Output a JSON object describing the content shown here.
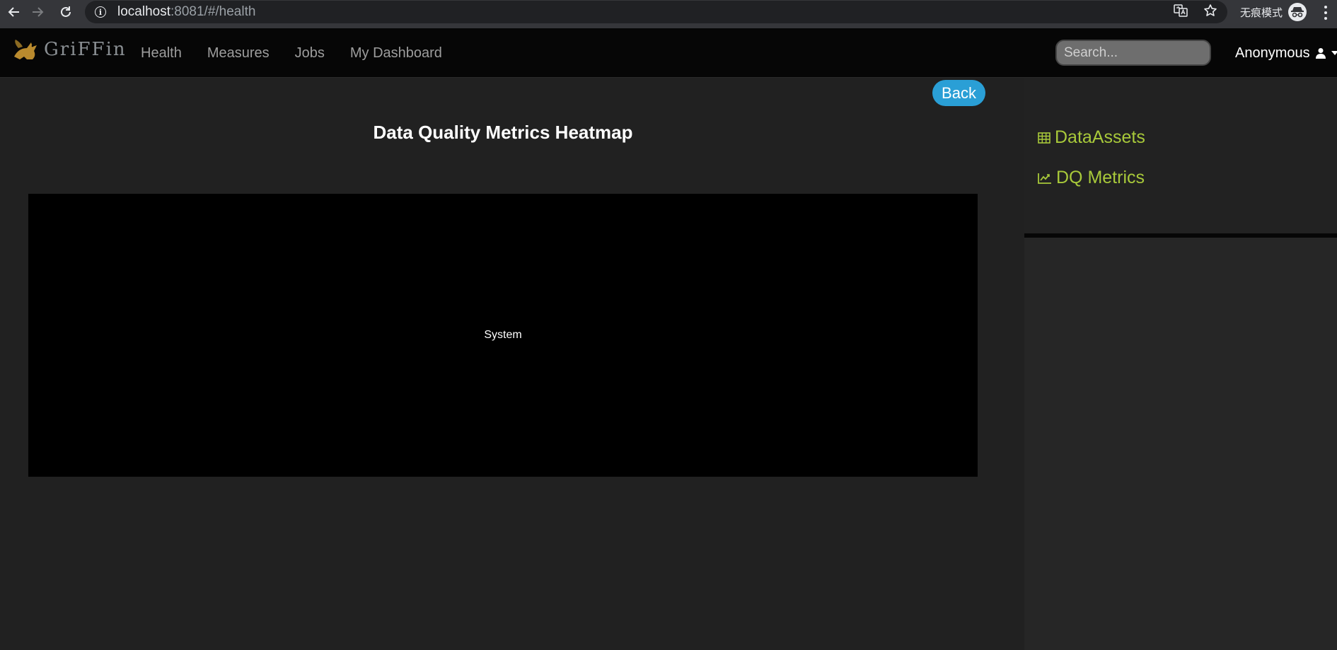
{
  "browser": {
    "url_host": "localhost",
    "url_path": ":8081/#/health",
    "incognito_label": "无痕模式",
    "icons": [
      "back-arrow-icon",
      "forward-arrow-icon",
      "reload-icon",
      "info-icon",
      "translate-icon",
      "bookmark-star-icon",
      "incognito-icon",
      "kebab-menu-icon"
    ]
  },
  "navbar": {
    "brand": "GriFFin",
    "links": [
      "Health",
      "Measures",
      "Jobs",
      "My Dashboard"
    ],
    "search_placeholder": "Search...",
    "user": "Anonymous",
    "icons": [
      "user-icon",
      "caret-down-icon"
    ]
  },
  "main": {
    "back_label": "Back",
    "title": "Data Quality Metrics Heatmap",
    "heatmap_label": "System"
  },
  "sidebar": {
    "items": [
      {
        "label": "DataAssets",
        "icon": "table-icon"
      },
      {
        "label": "DQ Metrics",
        "icon": "line-chart-icon"
      }
    ]
  },
  "colors": {
    "accent_blue": "#2a9fd6",
    "sidebar_link": "#a8c93a",
    "navbar_bg": "#060606",
    "page_bg": "#212121"
  }
}
